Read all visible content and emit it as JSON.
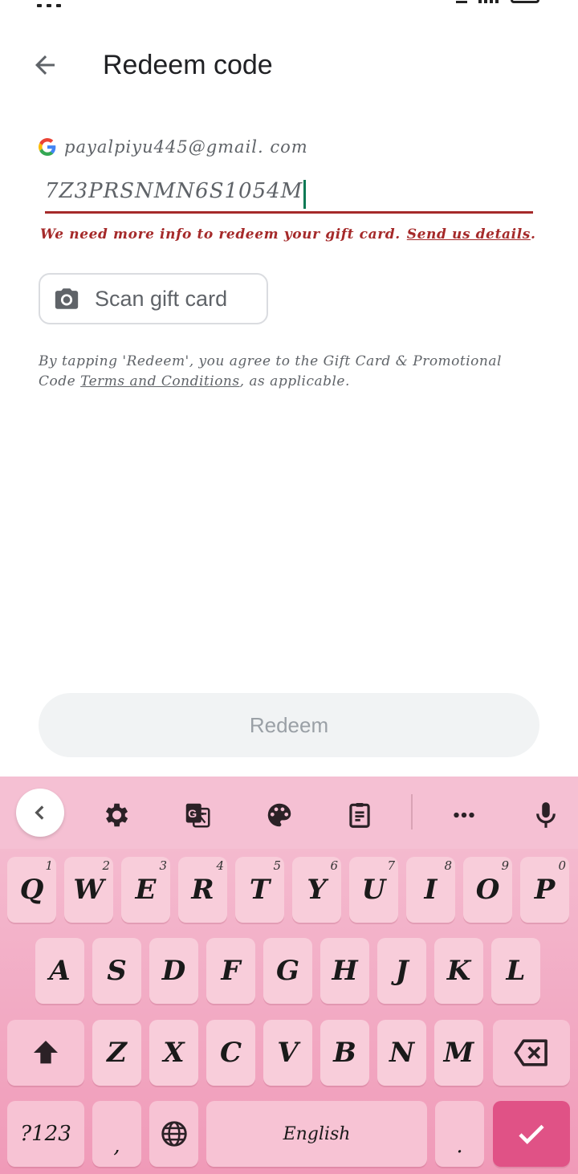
{
  "header": {
    "title": "Redeem code",
    "back_icon": "arrow-back-icon"
  },
  "account": {
    "email": "payalpiyu445@gmail. com",
    "logo": "google-g-logo"
  },
  "code_input": {
    "value": "7Z3PRSNMN6S1054M"
  },
  "error": {
    "message": "We need more info to redeem your gift card.",
    "link": "Send us details",
    "suffix": "."
  },
  "scan_button": {
    "label": "Scan gift card",
    "icon": "camera-icon"
  },
  "terms": {
    "prefix": "By tapping 'Redeem', you agree to the Gift Card & Promotional Code ",
    "link": "Terms and Conditions",
    "suffix": ", as applicable."
  },
  "redeem_button": {
    "label": "Redeem"
  },
  "keyboard": {
    "toolbar": [
      "collapse-icon",
      "settings-icon",
      "translate-icon",
      "palette-icon",
      "clipboard-icon",
      "more-icon",
      "mic-icon"
    ],
    "row1": [
      {
        "key": "Q",
        "hint": "1"
      },
      {
        "key": "W",
        "hint": "2"
      },
      {
        "key": "E",
        "hint": "3"
      },
      {
        "key": "R",
        "hint": "4"
      },
      {
        "key": "T",
        "hint": "5"
      },
      {
        "key": "Y",
        "hint": "6"
      },
      {
        "key": "U",
        "hint": "7"
      },
      {
        "key": "I",
        "hint": "8"
      },
      {
        "key": "O",
        "hint": "9"
      },
      {
        "key": "P",
        "hint": "0"
      }
    ],
    "row2": [
      "A",
      "S",
      "D",
      "F",
      "G",
      "H",
      "J",
      "K",
      "L"
    ],
    "row3": [
      "Z",
      "X",
      "C",
      "V",
      "B",
      "N",
      "M"
    ],
    "symbols_label": "?123",
    "comma": ",",
    "space_label": "English",
    "period": ".",
    "colors": {
      "enter": "#e05286",
      "key": "#f8cdda",
      "background": "#f5c0d3"
    }
  }
}
